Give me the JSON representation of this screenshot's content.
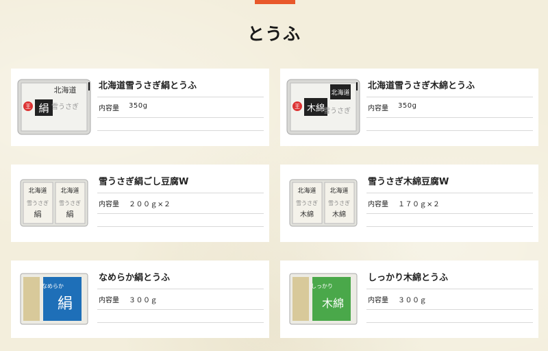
{
  "page": {
    "title": "とうふ"
  },
  "products": [
    {
      "name": "北海道雪うさぎ絹とうふ",
      "spec_label": "内容量",
      "spec_value": "350g",
      "package": "tub",
      "package_char": "絹",
      "package_band": "北海道",
      "package_sub": "雪うさぎ"
    },
    {
      "name": "北海道雪うさぎ木綿とうふ",
      "spec_label": "内容量",
      "spec_value": "350g",
      "package": "tub",
      "package_char": "木綿",
      "package_band": "北海道",
      "package_sub": "雪うさぎ"
    },
    {
      "name": "雪うさぎ絹ごし豆腐W",
      "spec_label": "内容量",
      "spec_value": "２００ｇ×２",
      "package": "twin",
      "package_char": "絹",
      "package_band": "北海道",
      "package_sub": "雪うさぎ"
    },
    {
      "name": "雪うさぎ木綿豆腐W",
      "spec_label": "内容量",
      "spec_value": "１７０ｇ×２",
      "package": "twin",
      "package_char": "木綿",
      "package_band": "北海道",
      "package_sub": "雪うさぎ"
    },
    {
      "name": "なめらか絹とうふ",
      "spec_label": "内容量",
      "spec_value": "３００ｇ",
      "package": "pack-blue",
      "package_char": "絹",
      "package_band": "なめらか",
      "package_sub": "",
      "package_color": "#1e6fb8"
    },
    {
      "name": "しっかり木綿とうふ",
      "spec_label": "内容量",
      "spec_value": "３００ｇ",
      "package": "pack-green",
      "package_char": "木綿",
      "package_band": "しっかり",
      "package_sub": "",
      "package_color": "#4aa84a"
    }
  ],
  "colors": {
    "accent": "#e8582a",
    "background": "#f3eedc",
    "card": "#ffffff"
  }
}
